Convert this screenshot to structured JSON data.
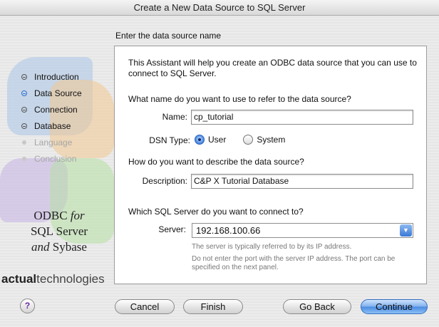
{
  "window": {
    "title": "Create a New Data Source to SQL Server"
  },
  "sidebar": {
    "steps": [
      {
        "label": "Introduction",
        "state": "done"
      },
      {
        "label": "Data Source",
        "state": "active"
      },
      {
        "label": "Connection",
        "state": "done"
      },
      {
        "label": "Database",
        "state": "done"
      },
      {
        "label": "Language",
        "state": "disabled"
      },
      {
        "label": "Conclusion",
        "state": "disabled"
      }
    ],
    "product_line1": "ODBC ",
    "product_for": "for",
    "product_line2": "SQL Server",
    "product_and": "and",
    "product_line3": " Sybase",
    "brand_bold": "actual",
    "brand_rest": "technologies"
  },
  "main": {
    "section_title": "Enter the data source name",
    "intro": "This Assistant will help you create an ODBC data source that you can use to connect to SQL Server.",
    "name_question": "What name do you want to use to refer to the data source?",
    "name_label": "Name:",
    "name_value": "cp_tutorial",
    "dsn_type_label": "DSN Type:",
    "dsn_options": [
      {
        "label": "User",
        "selected": true
      },
      {
        "label": "System",
        "selected": false
      }
    ],
    "describe_question": "How do you want to describe the data source?",
    "description_label": "Description:",
    "description_value": "C&P X Tutorial Database",
    "server_question": "Which SQL Server do you want to connect to?",
    "server_label": "Server:",
    "server_value": "192.168.100.66",
    "server_note1": "The server is typically referred to by its IP address.",
    "server_note2": "Do not enter the port with the server IP address. The port can be specified on the next panel."
  },
  "footer": {
    "help_label": "?",
    "cancel_label": "Cancel",
    "finish_label": "Finish",
    "go_back_label": "Go Back",
    "continue_label": "Continue"
  },
  "colors": {
    "accent": "#3a78d6",
    "active_step": "#2f6fd0"
  }
}
